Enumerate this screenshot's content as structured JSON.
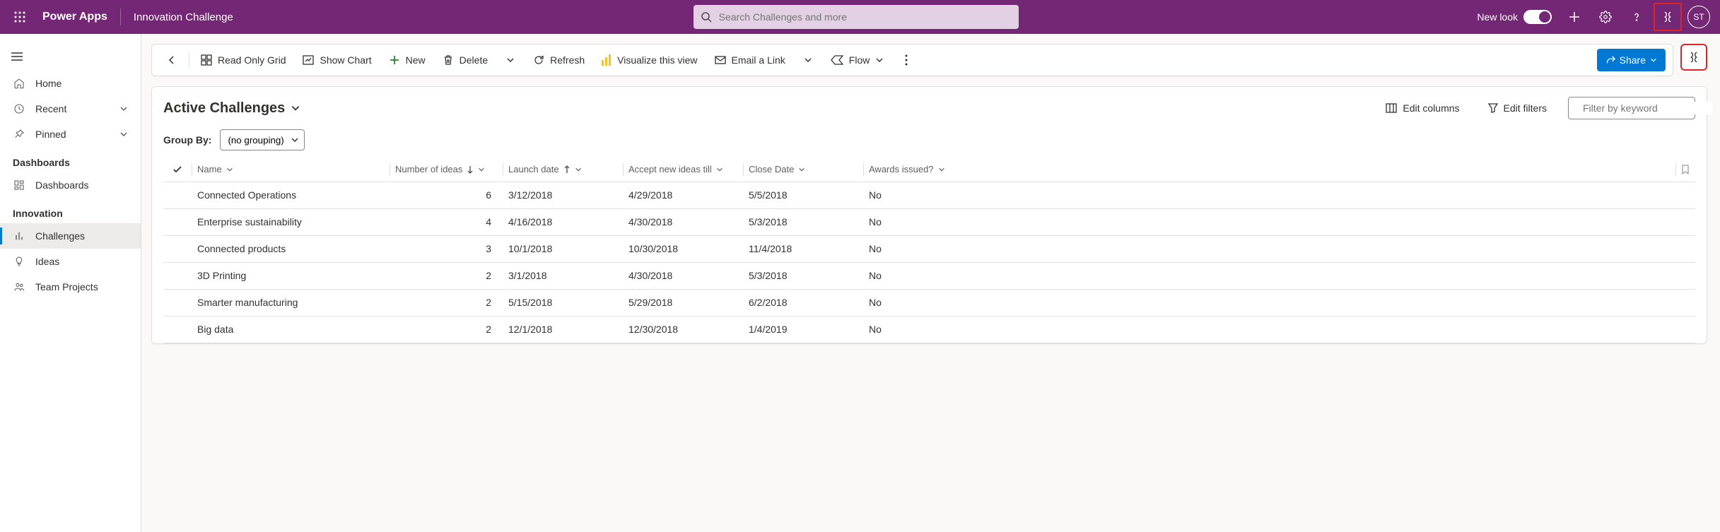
{
  "header": {
    "brand": "Power Apps",
    "app_name": "Innovation Challenge",
    "search_placeholder": "Search Challenges and more",
    "new_look_label": "New look",
    "avatar_initials": "ST"
  },
  "sidebar": {
    "home": "Home",
    "recent": "Recent",
    "pinned": "Pinned",
    "section_dashboards": "Dashboards",
    "dashboards_item": "Dashboards",
    "section_innovation": "Innovation",
    "challenges": "Challenges",
    "ideas": "Ideas",
    "team_projects": "Team Projects"
  },
  "cmdbar": {
    "read_only_grid": "Read Only Grid",
    "show_chart": "Show Chart",
    "new": "New",
    "delete": "Delete",
    "refresh": "Refresh",
    "visualize": "Visualize this view",
    "email_link": "Email a Link",
    "flow": "Flow",
    "share": "Share"
  },
  "view": {
    "title": "Active Challenges",
    "edit_columns": "Edit columns",
    "edit_filters": "Edit filters",
    "filter_placeholder": "Filter by keyword",
    "group_by_label": "Group By:",
    "group_by_value": "(no grouping)"
  },
  "columns": {
    "name": "Name",
    "number_of_ideas": "Number of ideas",
    "launch_date": "Launch date",
    "accept_till": "Accept new ideas till",
    "close_date": "Close Date",
    "awards_issued": "Awards issued?"
  },
  "rows": [
    {
      "name": "Connected Operations",
      "ideas": "6",
      "launch": "3/12/2018",
      "accept": "4/29/2018",
      "close": "5/5/2018",
      "awards": "No"
    },
    {
      "name": "Enterprise sustainability",
      "ideas": "4",
      "launch": "4/16/2018",
      "accept": "4/30/2018",
      "close": "5/3/2018",
      "awards": "No"
    },
    {
      "name": "Connected products",
      "ideas": "3",
      "launch": "10/1/2018",
      "accept": "10/30/2018",
      "close": "11/4/2018",
      "awards": "No"
    },
    {
      "name": "3D Printing",
      "ideas": "2",
      "launch": "3/1/2018",
      "accept": "4/30/2018",
      "close": "5/3/2018",
      "awards": "No"
    },
    {
      "name": "Smarter manufacturing",
      "ideas": "2",
      "launch": "5/15/2018",
      "accept": "5/29/2018",
      "close": "6/2/2018",
      "awards": "No"
    },
    {
      "name": "Big data",
      "ideas": "2",
      "launch": "12/1/2018",
      "accept": "12/30/2018",
      "close": "1/4/2019",
      "awards": "No"
    }
  ]
}
